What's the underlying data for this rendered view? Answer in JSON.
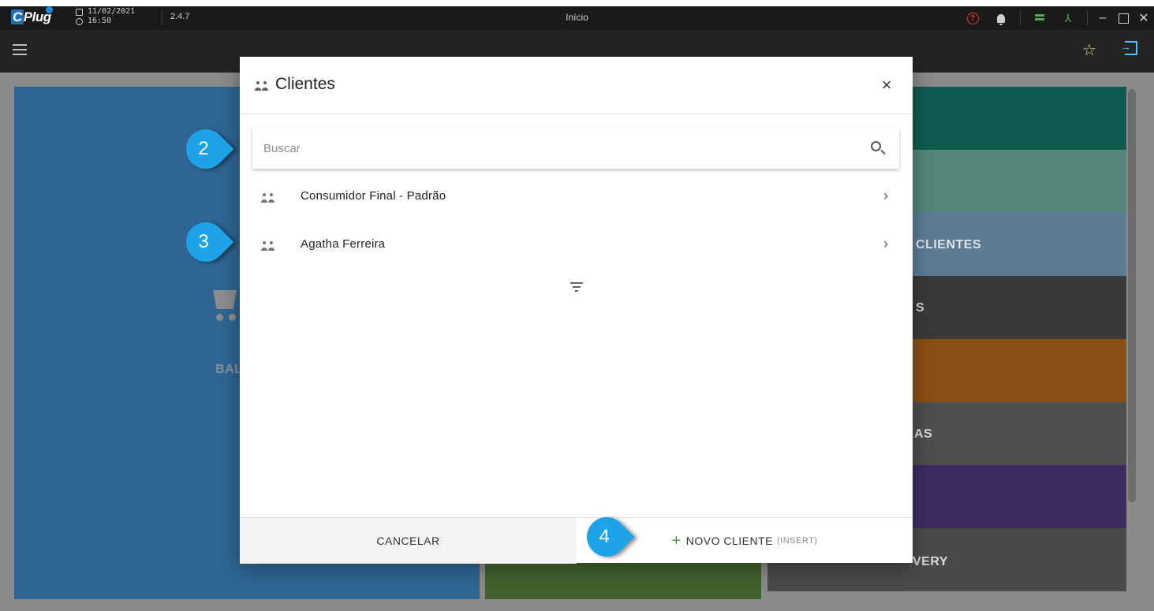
{
  "titlebar": {
    "logo": "Plug",
    "logo_c": "C",
    "date": "11/02/2021",
    "time": "16:50",
    "version": "2.4.7",
    "title": "Início",
    "minimize": "–",
    "close": "✕"
  },
  "toolbar": {
    "star": "☆"
  },
  "tiles": {
    "left_label": "BAL",
    "clientes": "CLIENTES",
    "s_label": "S",
    "as_label": "AS",
    "delivery": "VERY"
  },
  "dialog": {
    "title": "Clientes",
    "close": "×",
    "search": {
      "placeholder": "Buscar",
      "value": ""
    },
    "items": [
      {
        "name": "Consumidor Final - Padrão"
      },
      {
        "name": "Agatha Ferreira"
      }
    ],
    "chevron": "›",
    "footer": {
      "cancel": "CANCELAR",
      "new": "NOVO CLIENTE",
      "new_hint": "(INSERT)",
      "plus": "+"
    }
  },
  "callouts": [
    "2",
    "3",
    "4"
  ],
  "colors": {
    "callout": "#1ea3e8",
    "accent_green": "#43a047",
    "tile_blue": "#2d6a9f",
    "tile_teal": "#0e5b4f"
  }
}
